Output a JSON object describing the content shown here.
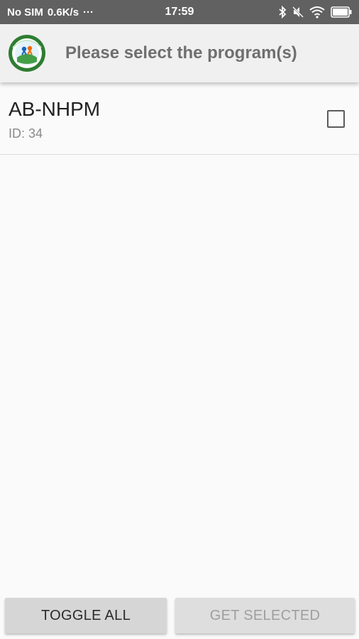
{
  "status_bar": {
    "carrier": "No SIM",
    "net_speed": "0.6K/s",
    "more": "···",
    "time": "17:59",
    "icons": [
      "bluetooth-icon",
      "mute-icon",
      "wifi-icon",
      "battery-icon"
    ]
  },
  "app_bar": {
    "title": "Please select the program(s)",
    "logo": "program-logo-icon"
  },
  "programs": [
    {
      "name": "AB-NHPM",
      "id_label": "ID: 34",
      "checked": false
    }
  ],
  "buttons": {
    "toggle_all": "TOGGLE ALL",
    "get_selected": "GET SELECTED"
  },
  "colors": {
    "status_bar_bg": "#616161",
    "app_bar_bg": "#f0f0f0",
    "button_bg": "#d6d6d6"
  }
}
